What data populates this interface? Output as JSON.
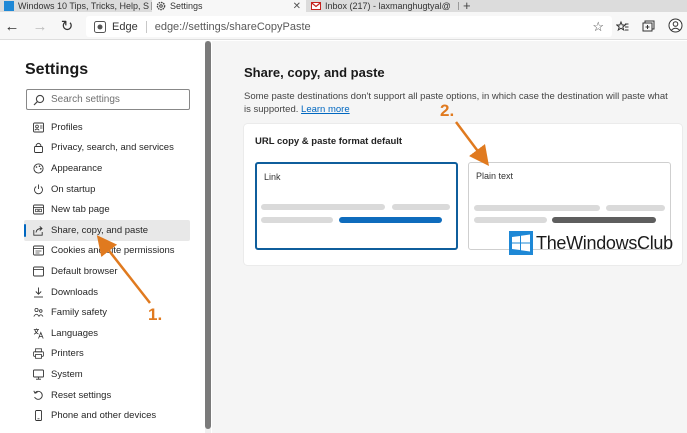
{
  "tabs": [
    {
      "title": "Windows 10 Tips, Tricks, Help, S",
      "close": "✕"
    },
    {
      "title": "Settings",
      "close": "✕"
    },
    {
      "title": "Inbox (217) - laxmanghugtyal@",
      "close": "✕"
    }
  ],
  "new_tab": "+",
  "toolbar": {
    "back": "←",
    "forward": "→",
    "refresh": "↻",
    "site_name": "Edge",
    "url": "edge://settings/shareCopyPaste",
    "favorite": "☆"
  },
  "nav": {
    "title": "Settings",
    "search_placeholder": "Search settings",
    "items": [
      {
        "label": "Profiles",
        "icon": "profile-icon"
      },
      {
        "label": "Privacy, search, and services",
        "icon": "lock-icon"
      },
      {
        "label": "Appearance",
        "icon": "appearance-icon"
      },
      {
        "label": "On startup",
        "icon": "power-icon"
      },
      {
        "label": "New tab page",
        "icon": "new-tab-icon"
      },
      {
        "label": "Share, copy, and paste",
        "icon": "share-icon"
      },
      {
        "label": "Cookies and site permissions",
        "icon": "cookies-icon"
      },
      {
        "label": "Default browser",
        "icon": "browser-icon"
      },
      {
        "label": "Downloads",
        "icon": "download-icon"
      },
      {
        "label": "Family safety",
        "icon": "family-icon"
      },
      {
        "label": "Languages",
        "icon": "language-icon"
      },
      {
        "label": "Printers",
        "icon": "printer-icon"
      },
      {
        "label": "System",
        "icon": "system-icon"
      },
      {
        "label": "Reset settings",
        "icon": "reset-icon"
      },
      {
        "label": "Phone and other devices",
        "icon": "phone-icon"
      }
    ]
  },
  "main": {
    "title": "Share, copy, and paste",
    "description": "Some paste destinations don't support all paste options, in which case the destination will paste what is supported.",
    "learn_more": "Learn more",
    "card_title": "URL copy & paste format default",
    "options": [
      {
        "label": "Link",
        "selected": true
      },
      {
        "label": "Plain text",
        "selected": false
      }
    ]
  },
  "annotations": {
    "step1": "1.",
    "step2": "2.",
    "arrow_color": "#e07a1f"
  },
  "watermark": "TheWindowsClub",
  "colors": {
    "accent": "#0067c0",
    "selected_border": "#0f5e9c",
    "annotation": "#e07a1f"
  }
}
